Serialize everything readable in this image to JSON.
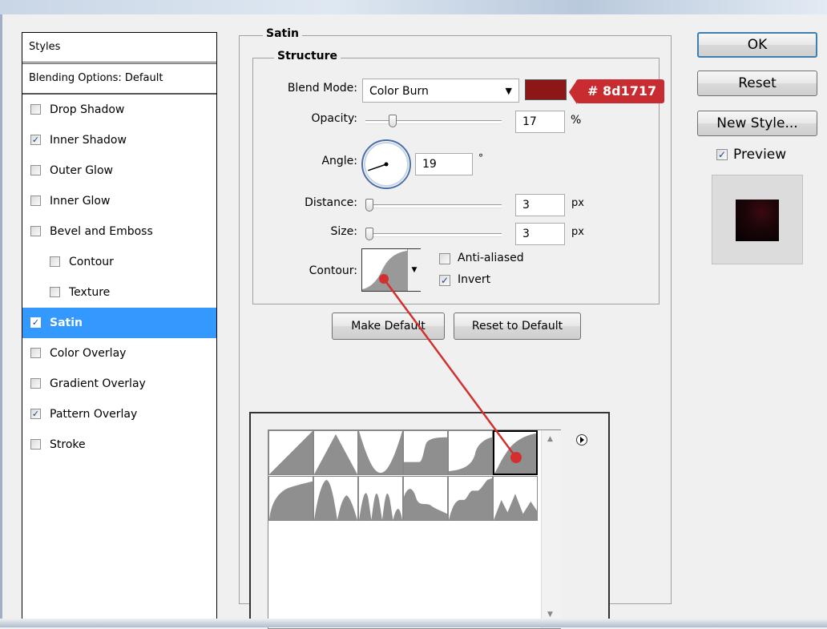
{
  "styles_panel": {
    "header": "Styles",
    "blending": "Blending Options: Default",
    "items": [
      {
        "label": "Drop Shadow",
        "checked": false,
        "indent": false,
        "selected": false
      },
      {
        "label": "Inner Shadow",
        "checked": true,
        "indent": false,
        "selected": false
      },
      {
        "label": "Outer Glow",
        "checked": false,
        "indent": false,
        "selected": false
      },
      {
        "label": "Inner Glow",
        "checked": false,
        "indent": false,
        "selected": false
      },
      {
        "label": "Bevel and Emboss",
        "checked": false,
        "indent": false,
        "selected": false
      },
      {
        "label": "Contour",
        "checked": false,
        "indent": true,
        "selected": false
      },
      {
        "label": "Texture",
        "checked": false,
        "indent": true,
        "selected": false
      },
      {
        "label": "Satin",
        "checked": true,
        "indent": false,
        "selected": true
      },
      {
        "label": "Color Overlay",
        "checked": false,
        "indent": false,
        "selected": false
      },
      {
        "label": "Gradient Overlay",
        "checked": false,
        "indent": false,
        "selected": false
      },
      {
        "label": "Pattern Overlay",
        "checked": true,
        "indent": false,
        "selected": false
      },
      {
        "label": "Stroke",
        "checked": false,
        "indent": false,
        "selected": false
      }
    ]
  },
  "satin": {
    "group_title": "Satin",
    "structure_title": "Structure",
    "blend_mode_label": "Blend Mode:",
    "blend_mode_value": "Color Burn",
    "color_swatch": "#8d1717",
    "color_badge": "# 8d1717",
    "opacity_label": "Opacity:",
    "opacity_value": "17",
    "opacity_unit": "%",
    "opacity_fraction": 0.17,
    "angle_label": "Angle:",
    "angle_value": "19",
    "angle_unit": "°",
    "distance_label": "Distance:",
    "distance_value": "3",
    "distance_unit": "px",
    "size_label": "Size:",
    "size_value": "3",
    "size_unit": "px",
    "contour_label": "Contour:",
    "anti_aliased_label": "Anti-aliased",
    "anti_aliased_checked": false,
    "invert_label": "Invert",
    "invert_checked": true,
    "make_default": "Make Default",
    "reset_to_default": "Reset to Default"
  },
  "buttons": {
    "ok": "OK",
    "reset": "Reset",
    "new_style": "New Style...",
    "preview_label": "Preview",
    "preview_checked": true
  },
  "contour_picker": {
    "presets": [
      "linear",
      "cone",
      "cone-inverted",
      "cove-deep",
      "cove-shallow",
      "gaussian",
      "half-round",
      "ring",
      "ring-double",
      "rolling-slope",
      "rounded-steps",
      "sawtooth"
    ],
    "selected_index": 5
  },
  "colors": {
    "accent_red": "#c82b30",
    "selection_blue": "#3399ff",
    "swatch": "#8d1717"
  }
}
